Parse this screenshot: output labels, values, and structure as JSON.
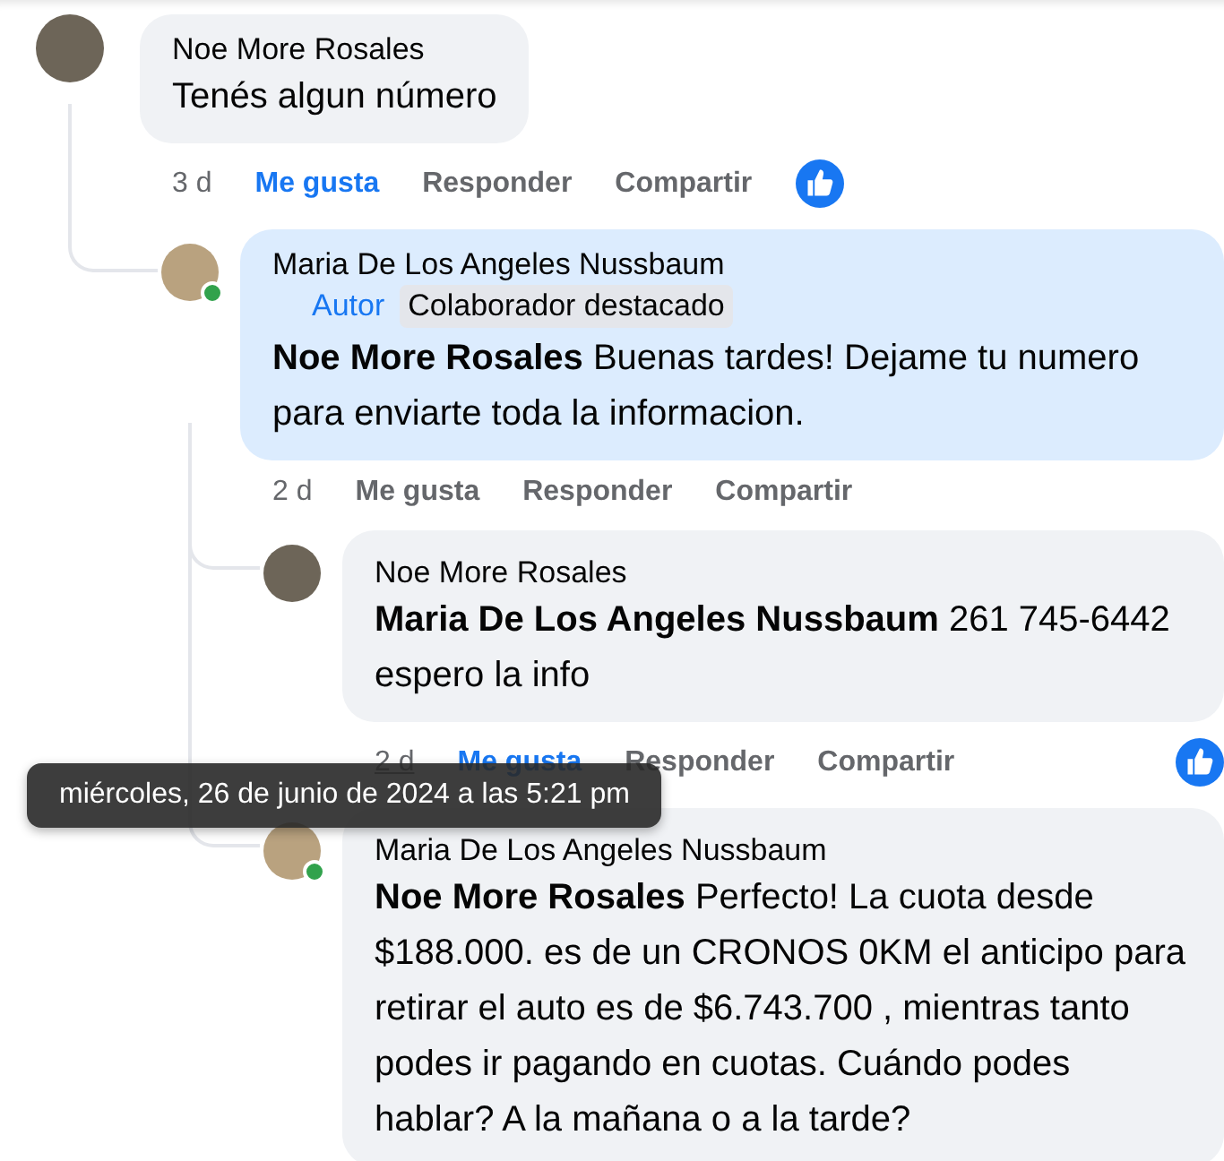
{
  "comments": [
    {
      "author": "Noe More Rosales",
      "online": false,
      "highlighted": false,
      "text": "Tenés algun número",
      "time": "3 d",
      "time_hovered": false,
      "like": "Me gusta",
      "liked": true,
      "reply": "Responder",
      "share": "Compartir",
      "reacted": true,
      "children": [
        {
          "author": "Maria De Los Angeles Nussbaum",
          "online": true,
          "highlighted": true,
          "badges": [
            {
              "kind": "role",
              "label": "Autor"
            },
            {
              "kind": "tag",
              "label": "Colaborador destacado"
            }
          ],
          "mention": "Noe More Rosales",
          "text": "Buenas tardes! Dejame tu numero para enviarte toda la informacion.",
          "time": "2 d",
          "time_hovered": false,
          "like": "Me gusta",
          "liked": false,
          "reply": "Responder",
          "share": "Compartir",
          "reacted": false,
          "children": [
            {
              "author": "Noe More Rosales",
              "online": false,
              "highlighted": false,
              "mention": "Maria De Los Angeles Nussbaum",
              "text": "261 745-6442 espero la info",
              "time": "2 d",
              "time_hovered": true,
              "like": "Me gusta",
              "liked": true,
              "reply": "Responder",
              "share": "Compartir",
              "reacted": true
            },
            {
              "author": "Maria De Los Angeles Nussbaum",
              "online": true,
              "highlighted": false,
              "mention": "Noe More Rosales",
              "text": "Perfecto! La cuota desde $188.000. es de un CRONOS 0KM el anticipo para retirar el auto es de $6.743.700 , mientras tanto podes ir pagando en cuotas. Cuándo podes hablar? A la mañana o a la tarde?"
            }
          ]
        }
      ]
    }
  ],
  "tooltip": "miércoles, 26 de junio de 2024 a las 5:21 pm"
}
